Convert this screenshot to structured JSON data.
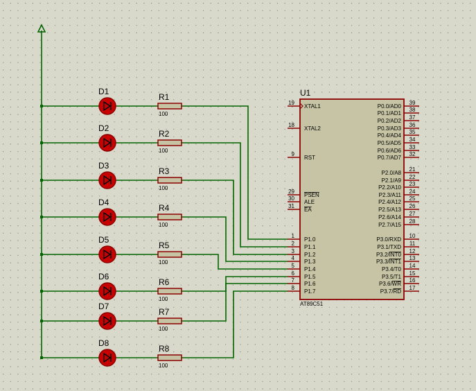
{
  "colors": {
    "background": "#d9d9cb",
    "grid_dot": "#8f8f80",
    "wire": "#006400",
    "part_outline": "#8b0000",
    "chip_fill": "#c6c4a4",
    "resistor_fill": "#c6c4a4",
    "led_fill": "#c80000",
    "text": "#000000"
  },
  "ground_symbol": "ground-arrow",
  "leds": [
    {
      "ref": "D1"
    },
    {
      "ref": "D2"
    },
    {
      "ref": "D3"
    },
    {
      "ref": "D4"
    },
    {
      "ref": "D5"
    },
    {
      "ref": "D6"
    },
    {
      "ref": "D7"
    },
    {
      "ref": "D8"
    }
  ],
  "resistors": [
    {
      "ref": "R1",
      "value": "100"
    },
    {
      "ref": "R2",
      "value": "100"
    },
    {
      "ref": "R3",
      "value": "100"
    },
    {
      "ref": "R4",
      "value": "100"
    },
    {
      "ref": "R5",
      "value": "100"
    },
    {
      "ref": "R6",
      "value": "100"
    },
    {
      "ref": "R7",
      "value": "100"
    },
    {
      "ref": "R8",
      "value": "100"
    }
  ],
  "chip": {
    "ref": "U1",
    "part": "AT89C51",
    "left_pins": [
      {
        "name": "XTAL1",
        "num": "19",
        "overline": false,
        "clock": true
      },
      {
        "name": "XTAL2",
        "num": "18",
        "overline": false,
        "clock": false
      },
      {
        "name": "RST",
        "num": "9",
        "overline": false,
        "clock": false
      },
      {
        "name": "PSEN",
        "num": "29",
        "overline": true,
        "clock": false
      },
      {
        "name": "ALE",
        "num": "30",
        "overline": false,
        "clock": false
      },
      {
        "name": "EA",
        "num": "31",
        "overline": true,
        "clock": false
      },
      {
        "name": "P1.0",
        "num": "1",
        "overline": false,
        "clock": false
      },
      {
        "name": "P1.1",
        "num": "2",
        "overline": false,
        "clock": false
      },
      {
        "name": "P1.2",
        "num": "3",
        "overline": false,
        "clock": false
      },
      {
        "name": "P1.3",
        "num": "4",
        "overline": false,
        "clock": false
      },
      {
        "name": "P1.4",
        "num": "5",
        "overline": false,
        "clock": false
      },
      {
        "name": "P1.5",
        "num": "6",
        "overline": false,
        "clock": false
      },
      {
        "name": "P1.6",
        "num": "7",
        "overline": false,
        "clock": false
      },
      {
        "name": "P1.7",
        "num": "8",
        "overline": false,
        "clock": false
      }
    ],
    "right_pins": [
      {
        "name": "P0.0/AD0",
        "num": "39"
      },
      {
        "name": "P0.1/AD1",
        "num": "38"
      },
      {
        "name": "P0.2/AD2",
        "num": "37"
      },
      {
        "name": "P0.3/AD3",
        "num": "36"
      },
      {
        "name": "P0.4/AD4",
        "num": "35"
      },
      {
        "name": "P0.5/AD5",
        "num": "34"
      },
      {
        "name": "P0.6/AD6",
        "num": "33"
      },
      {
        "name": "P0.7/AD7",
        "num": "32"
      },
      {
        "name": "P2.0/A8",
        "num": "21"
      },
      {
        "name": "P2.1/A9",
        "num": "22"
      },
      {
        "name": "P2.2/A10",
        "num": "23"
      },
      {
        "name": "P2.3/A11",
        "num": "24"
      },
      {
        "name": "P2.4/A12",
        "num": "25"
      },
      {
        "name": "P2.5/A13",
        "num": "26"
      },
      {
        "name": "P2.6/A14",
        "num": "27"
      },
      {
        "name": "P2.7/A15",
        "num": "28"
      },
      {
        "name": "P3.0/RXD",
        "num": "10"
      },
      {
        "name": "P3.1/TXD",
        "num": "11"
      },
      {
        "name": "P3.2/INT0",
        "num": "12",
        "bar": "INT0"
      },
      {
        "name": "P3.3/INT1",
        "num": "13",
        "bar": "INT1"
      },
      {
        "name": "P3.4/T0",
        "num": "14"
      },
      {
        "name": "P3.5/T1",
        "num": "15"
      },
      {
        "name": "P3.6/WR",
        "num": "16",
        "bar": "WR"
      },
      {
        "name": "P3.7/RD",
        "num": "17",
        "bar": "RD"
      }
    ]
  }
}
